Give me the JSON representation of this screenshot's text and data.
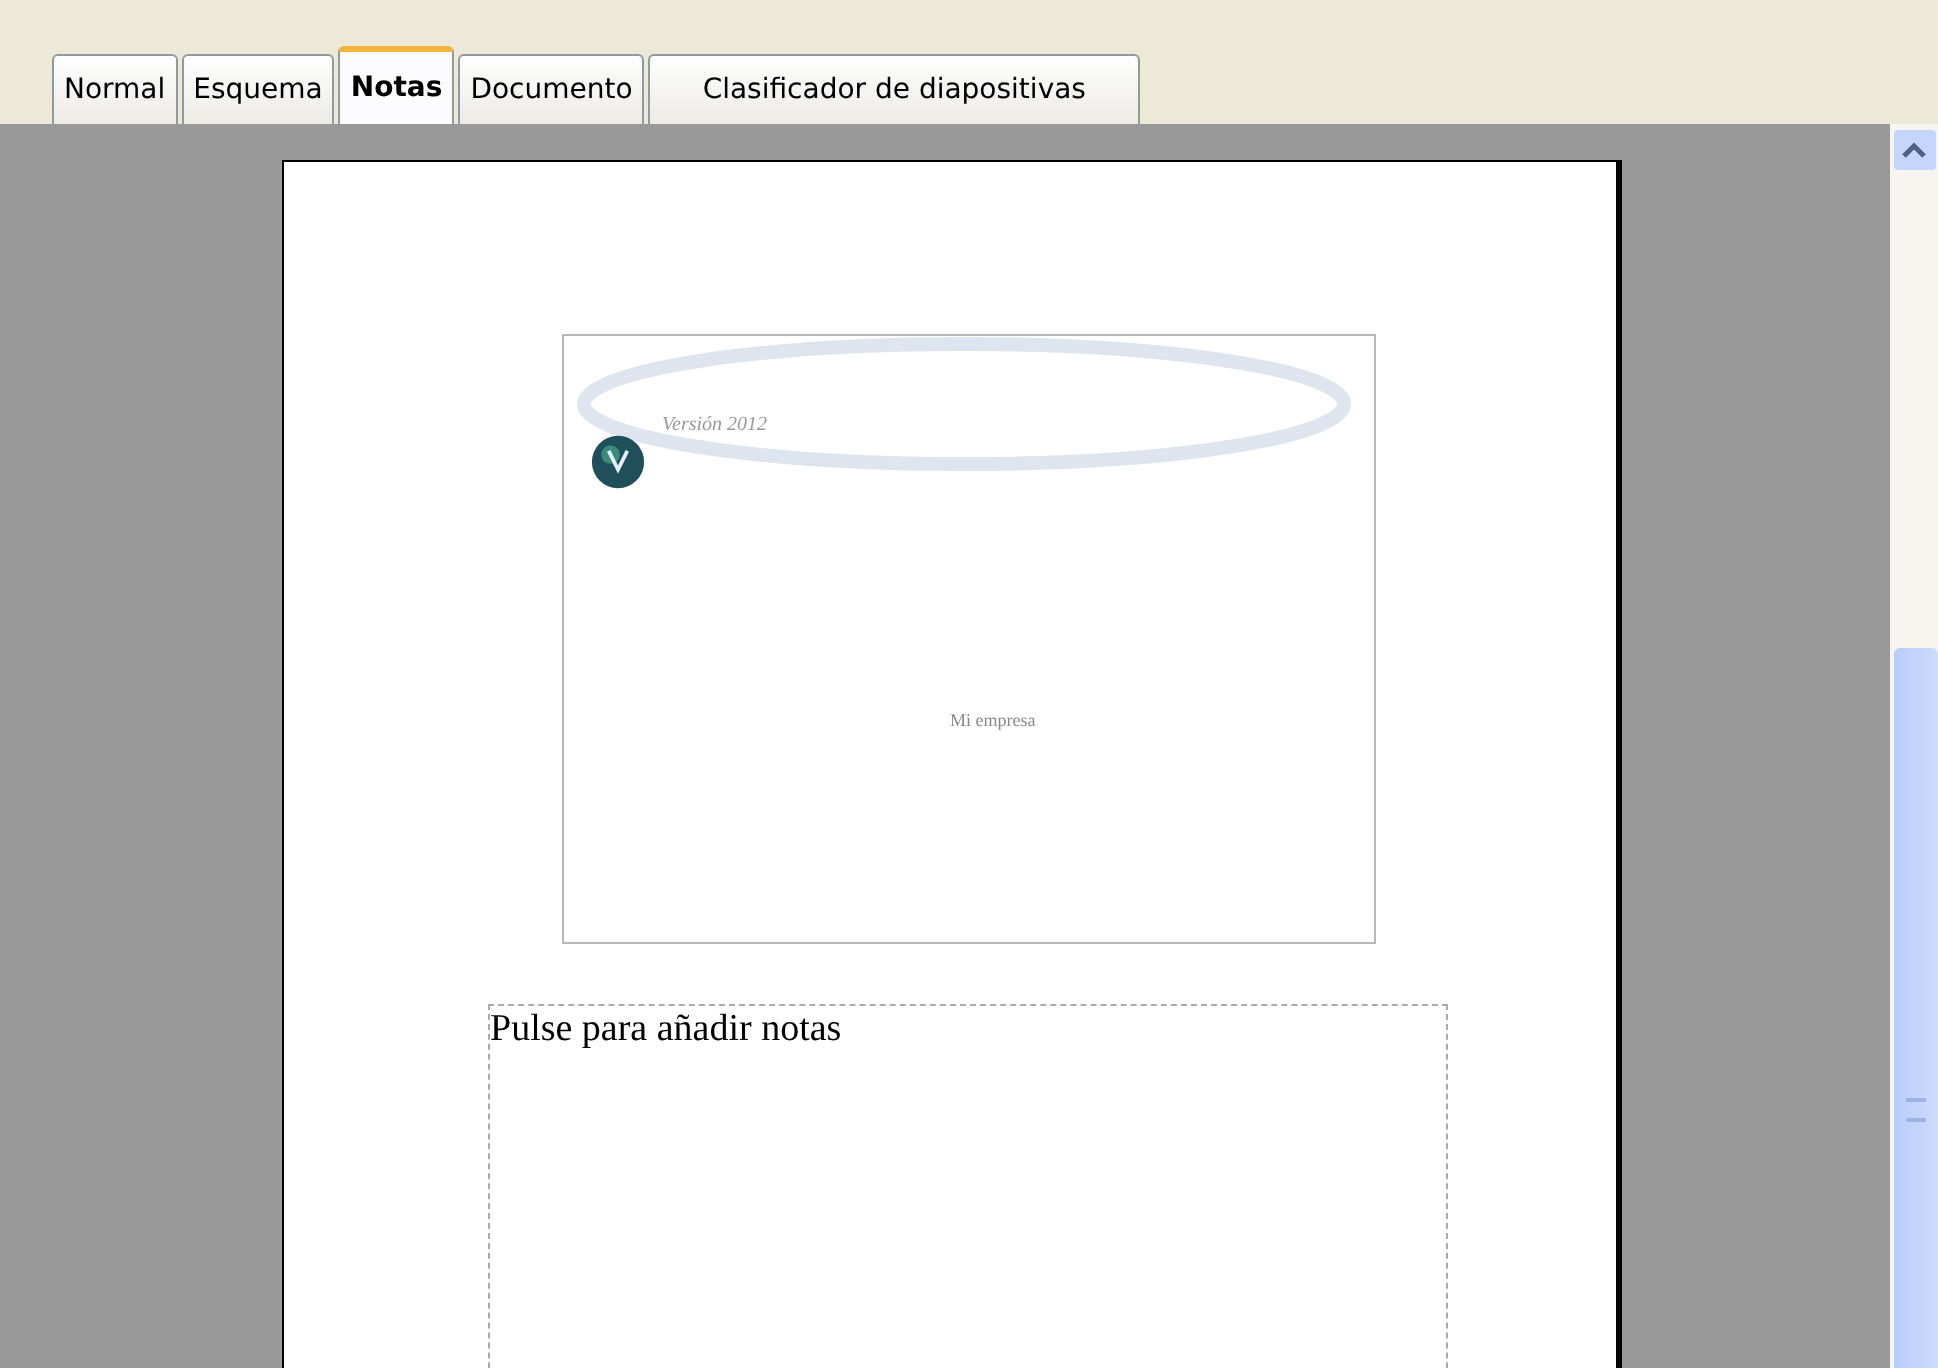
{
  "tabs": [
    {
      "label": "Normal",
      "selected": false
    },
    {
      "label": "Esquema",
      "selected": false
    },
    {
      "label": "Notas",
      "selected": true
    },
    {
      "label": "Documento",
      "selected": false
    },
    {
      "label": "Clasificador de diapositivas",
      "selected": false
    }
  ],
  "slide": {
    "subtitle": "Versión 2012",
    "company": "Mi empresa"
  },
  "notes": {
    "placeholder": "Pulse para añadir notas"
  }
}
